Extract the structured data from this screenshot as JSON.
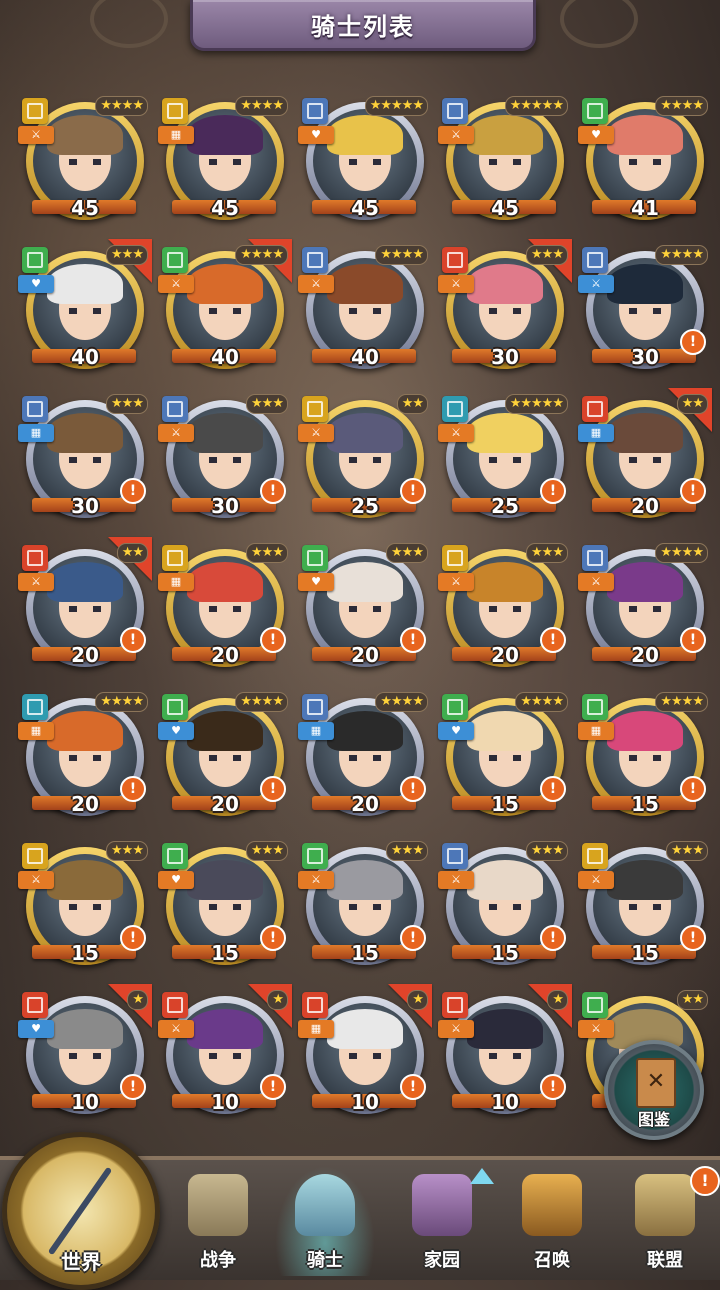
{
  "header": {
    "title": "骑士列表"
  },
  "colors": {
    "type_teal": "#2f9bb0",
    "type_green": "#3fae4e",
    "type_red": "#d9432a",
    "type_yellow": "#d8a41e",
    "type_blue": "#4d77b8",
    "role_orange": "#e47a25",
    "role_blue": "#3d8fd6"
  },
  "knights": [
    {
      "level": "45",
      "stars": "★★★★",
      "frame": "gold",
      "type": "yellow",
      "role": "orange",
      "role_icon": "sword",
      "hair": "#8a6b4a",
      "alert": false,
      "ribbon": false
    },
    {
      "level": "45",
      "stars": "★★★★",
      "frame": "gold",
      "type": "yellow",
      "role": "orange",
      "role_icon": "shield",
      "hair": "#4a2a5a",
      "alert": false,
      "ribbon": false
    },
    {
      "level": "45",
      "stars": "★★★★★",
      "frame": "silver",
      "type": "blue",
      "role": "orange",
      "role_icon": "heart",
      "hair": "#e8c24a",
      "alert": false,
      "ribbon": false
    },
    {
      "level": "45",
      "stars": "★★★★★",
      "frame": "gold",
      "type": "blue",
      "role": "orange",
      "role_icon": "sword",
      "hair": "#c9a040",
      "alert": false,
      "ribbon": false
    },
    {
      "level": "41",
      "stars": "★★★★",
      "frame": "gold",
      "type": "green",
      "role": "orange",
      "role_icon": "heart",
      "hair": "#e07b6a",
      "alert": false,
      "ribbon": false
    },
    {
      "level": "40",
      "stars": "★★★",
      "frame": "gold",
      "type": "green",
      "role": "blue",
      "role_icon": "heart",
      "hair": "#e8e8e8",
      "alert": false,
      "ribbon": true
    },
    {
      "level": "40",
      "stars": "★★★★",
      "frame": "gold",
      "type": "green",
      "role": "orange",
      "role_icon": "sword",
      "hair": "#d86a2a",
      "alert": false,
      "ribbon": true
    },
    {
      "level": "40",
      "stars": "★★★★",
      "frame": "silver",
      "type": "blue",
      "role": "orange",
      "role_icon": "sword",
      "hair": "#8a4a2a",
      "alert": false,
      "ribbon": false
    },
    {
      "level": "30",
      "stars": "★★★",
      "frame": "gold",
      "type": "red",
      "role": "orange",
      "role_icon": "sword",
      "hair": "#e07a8a",
      "alert": false,
      "ribbon": true
    },
    {
      "level": "30",
      "stars": "★★★★",
      "frame": "silver",
      "type": "blue",
      "role": "blue",
      "role_icon": "sword",
      "hair": "#1e2a3a",
      "alert": true,
      "ribbon": false
    },
    {
      "level": "30",
      "stars": "★★★",
      "frame": "silver",
      "type": "blue",
      "role": "blue",
      "role_icon": "shield",
      "hair": "#7a5a3a",
      "alert": true,
      "ribbon": false
    },
    {
      "level": "30",
      "stars": "★★★",
      "frame": "silver",
      "type": "blue",
      "role": "orange",
      "role_icon": "sword",
      "hair": "#4a4a4a",
      "alert": true,
      "ribbon": false
    },
    {
      "level": "25",
      "stars": "★★",
      "frame": "gold",
      "type": "yellow",
      "role": "orange",
      "role_icon": "sword",
      "hair": "#5a5a7a",
      "alert": true,
      "ribbon": false
    },
    {
      "level": "25",
      "stars": "★★★★★",
      "frame": "silver",
      "type": "teal",
      "role": "orange",
      "role_icon": "sword",
      "hair": "#f0d060",
      "alert": true,
      "ribbon": false
    },
    {
      "level": "20",
      "stars": "★★",
      "frame": "gold",
      "type": "red",
      "role": "blue",
      "role_icon": "shield",
      "hair": "#6a4a3a",
      "alert": true,
      "ribbon": true
    },
    {
      "level": "20",
      "stars": "★★",
      "frame": "silver",
      "type": "red",
      "role": "orange",
      "role_icon": "sword",
      "hair": "#3a5a8a",
      "alert": true,
      "ribbon": true
    },
    {
      "level": "20",
      "stars": "★★★",
      "frame": "gold",
      "type": "yellow",
      "role": "orange",
      "role_icon": "shield",
      "hair": "#d84a3a",
      "alert": true,
      "ribbon": false
    },
    {
      "level": "20",
      "stars": "★★★",
      "frame": "silver",
      "type": "green",
      "role": "orange",
      "role_icon": "heart",
      "hair": "#e8e0d8",
      "alert": true,
      "ribbon": false
    },
    {
      "level": "20",
      "stars": "★★★",
      "frame": "gold",
      "type": "yellow",
      "role": "orange",
      "role_icon": "sword",
      "hair": "#c8842a",
      "alert": true,
      "ribbon": false
    },
    {
      "level": "20",
      "stars": "★★★★",
      "frame": "silver",
      "type": "blue",
      "role": "orange",
      "role_icon": "sword",
      "hair": "#7a3a8a",
      "alert": true,
      "ribbon": false
    },
    {
      "level": "20",
      "stars": "★★★★",
      "frame": "silver",
      "type": "teal",
      "role": "orange",
      "role_icon": "shield",
      "hair": "#d86a2a",
      "alert": true,
      "ribbon": false
    },
    {
      "level": "20",
      "stars": "★★★★",
      "frame": "gold",
      "type": "green",
      "role": "blue",
      "role_icon": "heart",
      "hair": "#3a2a1a",
      "alert": true,
      "ribbon": false
    },
    {
      "level": "20",
      "stars": "★★★★",
      "frame": "silver",
      "type": "blue",
      "role": "blue",
      "role_icon": "shield",
      "hair": "#2a2a2a",
      "alert": true,
      "ribbon": false
    },
    {
      "level": "15",
      "stars": "★★★★",
      "frame": "gold",
      "type": "green",
      "role": "blue",
      "role_icon": "heart",
      "hair": "#f0d8b0",
      "alert": true,
      "ribbon": false
    },
    {
      "level": "15",
      "stars": "★★★★",
      "frame": "gold",
      "type": "green",
      "role": "orange",
      "role_icon": "shield",
      "hair": "#d8487a",
      "alert": true,
      "ribbon": false
    },
    {
      "level": "15",
      "stars": "★★★",
      "frame": "gold",
      "type": "yellow",
      "role": "orange",
      "role_icon": "sword",
      "hair": "#8a6a3a",
      "alert": true,
      "ribbon": false
    },
    {
      "level": "15",
      "stars": "★★★",
      "frame": "gold",
      "type": "green",
      "role": "orange",
      "role_icon": "heart",
      "hair": "#4a4a5a",
      "alert": true,
      "ribbon": false
    },
    {
      "level": "15",
      "stars": "★★★",
      "frame": "silver",
      "type": "green",
      "role": "orange",
      "role_icon": "sword",
      "hair": "#9a9aa0",
      "alert": true,
      "ribbon": false
    },
    {
      "level": "15",
      "stars": "★★★",
      "frame": "silver",
      "type": "blue",
      "role": "orange",
      "role_icon": "sword",
      "hair": "#e8d8c8",
      "alert": true,
      "ribbon": false
    },
    {
      "level": "15",
      "stars": "★★★",
      "frame": "silver",
      "type": "yellow",
      "role": "orange",
      "role_icon": "sword",
      "hair": "#3a3a3a",
      "alert": true,
      "ribbon": false
    },
    {
      "level": "10",
      "stars": "★",
      "frame": "silver",
      "type": "red",
      "role": "blue",
      "role_icon": "heart",
      "hair": "#8a8a8a",
      "alert": true,
      "ribbon": true
    },
    {
      "level": "10",
      "stars": "★",
      "frame": "silver",
      "type": "red",
      "role": "orange",
      "role_icon": "sword",
      "hair": "#6a3a8a",
      "alert": true,
      "ribbon": true
    },
    {
      "level": "10",
      "stars": "★",
      "frame": "silver",
      "type": "red",
      "role": "orange",
      "role_icon": "shield",
      "hair": "#e8e8e8",
      "alert": true,
      "ribbon": true
    },
    {
      "level": "10",
      "stars": "★",
      "frame": "silver",
      "type": "red",
      "role": "orange",
      "role_icon": "sword",
      "hair": "#2a2a3a",
      "alert": true,
      "ribbon": true
    },
    {
      "level": "",
      "stars": "★★",
      "frame": "gold",
      "type": "green",
      "role": "orange",
      "role_icon": "sword",
      "hair": "#a08a5a",
      "alert": false,
      "ribbon": false
    }
  ],
  "codex": {
    "label": "图鉴",
    "icon": "book-icon"
  },
  "nav": {
    "world": "世界",
    "war": "战争",
    "knight": "骑士",
    "home": "家园",
    "summon": "召唤",
    "alliance": "联盟",
    "alliance_alert": "!"
  }
}
